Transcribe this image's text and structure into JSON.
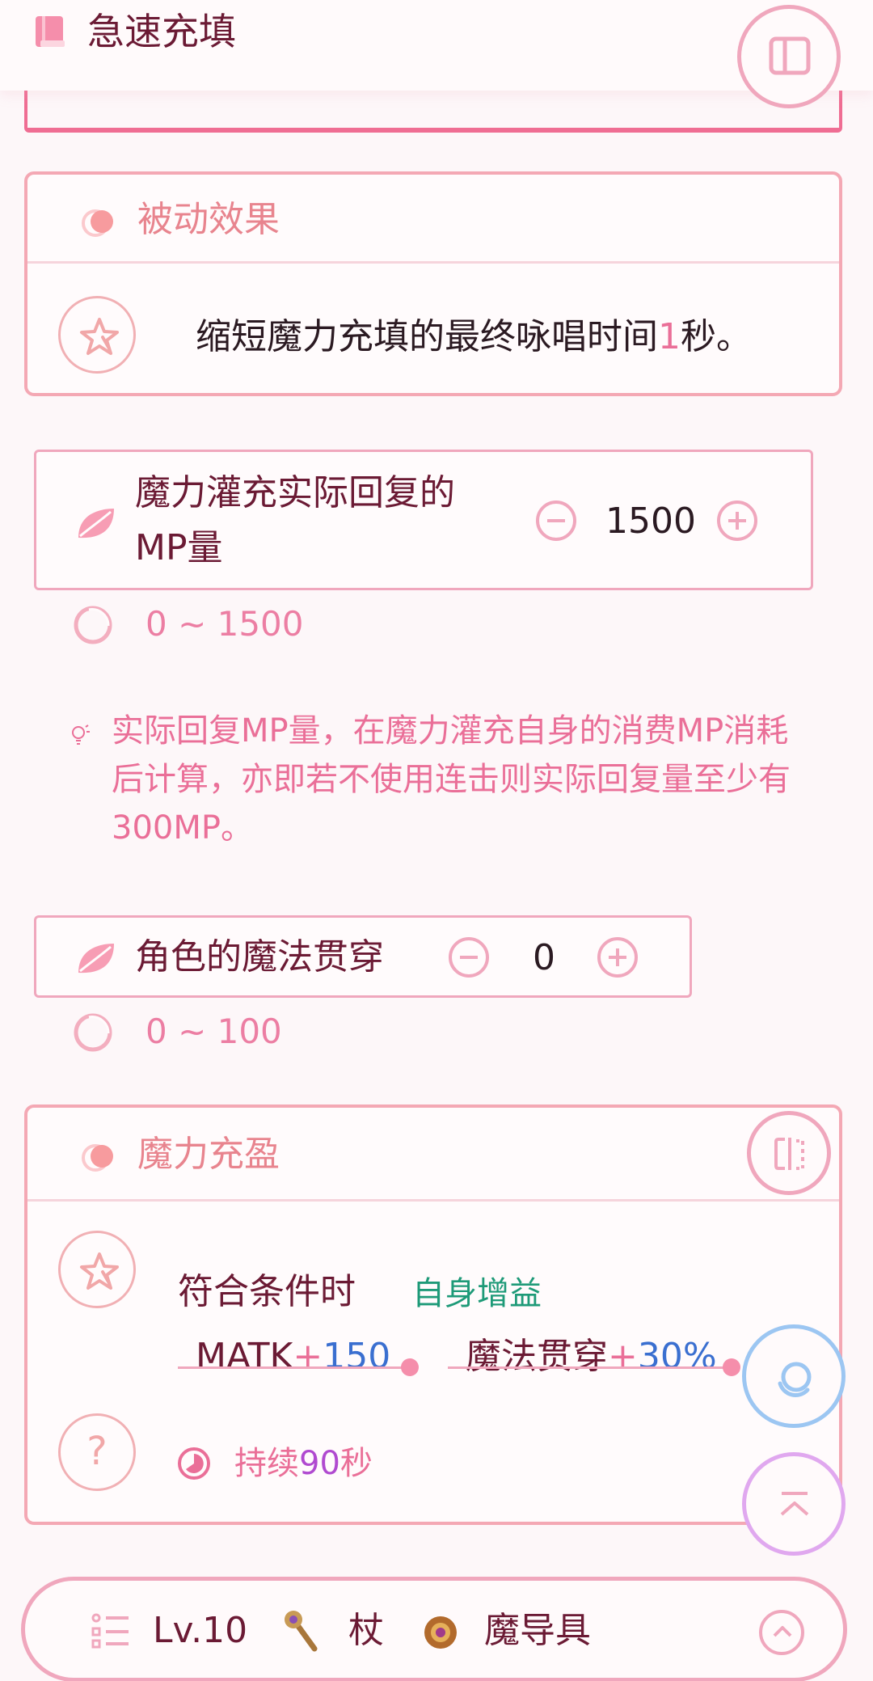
{
  "header": {
    "title": "急速充填",
    "book_icon": "book-icon",
    "toc_icon": "sidebar-toggle-icon"
  },
  "passive": {
    "title": "被动效果",
    "text_before": "缩短魔力充填的最终咏唱时间",
    "highlight": "1",
    "text_after": "秒。"
  },
  "mp_stepper": {
    "label_line1": "魔力灌充实际回复的",
    "label_line2": "MP量",
    "value": "1500",
    "range": "0 ~ 1500"
  },
  "tip": {
    "text": "实际回复MP量，在魔力灌充自身的消费MP消耗后计算，亦即若不使用连击则实际回复量至少有300MP。"
  },
  "pen_stepper": {
    "label": "角色的魔法贯穿",
    "value": "0",
    "range": "0 ~ 100"
  },
  "buff": {
    "title": "魔力充盈",
    "condition": "符合条件时",
    "target": "自身增益",
    "stat1_name": "MATK",
    "stat1_plus": "+",
    "stat1_value": "150",
    "stat2_name": "魔法贯穿",
    "stat2_plus": "+",
    "stat2_value": "30%",
    "duration_pre": "持续",
    "duration_value": "90",
    "duration_post": "秒",
    "help_label": "?"
  },
  "bottom": {
    "level": "Lv.10",
    "weapon1": "杖",
    "weapon2": "魔导具"
  },
  "colors": {
    "accent_pink": "#f0a7bd",
    "title_salmon": "#e8848e",
    "text_dark": "#6b1a34",
    "buff_green": "#1e9a78",
    "value_blue": "#3a6fd0",
    "float_blue": "#9cc6f2",
    "float_violet": "#e0a8ef"
  }
}
